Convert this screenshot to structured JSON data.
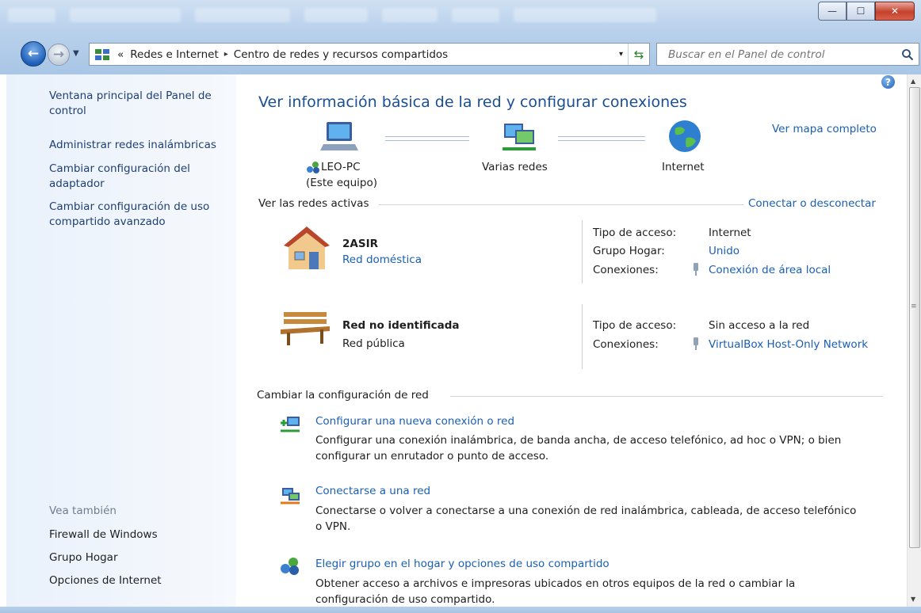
{
  "window": {
    "minimize": "—",
    "maximize": "☐",
    "close": "✕"
  },
  "address": {
    "overflow": "«",
    "crumb1": "Redes e Internet",
    "sep": "▸",
    "crumb2": "Centro de redes y recursos compartidos",
    "dropdown": "▾",
    "refresh": "⇆"
  },
  "search": {
    "placeholder": "Buscar en el Panel de control"
  },
  "sidebar": {
    "link1": "Ventana principal del Panel de control",
    "link2": "Administrar redes inalámbricas",
    "link3": "Cambiar configuración del adaptador",
    "link4": "Cambiar configuración de uso compartido avanzado",
    "see_also": "Vea también",
    "see1": "Firewall de Windows",
    "see2": "Grupo Hogar",
    "see3": "Opciones de Internet"
  },
  "main": {
    "title": "Ver información básica de la red y configurar conexiones",
    "full_map": "Ver mapa completo",
    "node1_name": "LEO-PC",
    "node1_sub": "(Este equipo)",
    "node2_name": "Varias redes",
    "node3_name": "Internet",
    "active_header": "Ver las redes activas",
    "connect_link": "Conectar o desconectar",
    "net1": {
      "name": "2ASIR",
      "type": "Red doméstica",
      "access_label": "Tipo de acceso:",
      "access_value": "Internet",
      "group_label": "Grupo Hogar:",
      "group_value": "Unido",
      "conn_label": "Conexiones:",
      "conn_value": "Conexión de área local"
    },
    "net2": {
      "name": "Red no identificada",
      "type": "Red pública",
      "access_label": "Tipo de acceso:",
      "access_value": "Sin acceso a la red",
      "conn_label": "Conexiones:",
      "conn_value": "VirtualBox Host-Only Network"
    },
    "change_header": "Cambiar la configuración de red",
    "task1_link": "Configurar una nueva conexión o red",
    "task1_desc1": "Configurar una conexión inalámbrica, de banda ancha, de acceso telefónico, ad hoc o VPN; o bien",
    "task1_desc2": "configurar un enrutador o punto de acceso.",
    "task2_link": "Conectarse a una red",
    "task2_desc1": "Conectarse o volver a conectarse a una conexión de red inalámbrica, cableada, de acceso telefónico",
    "task2_desc2": "o VPN.",
    "task3_link": "Elegir grupo en el hogar y opciones de uso compartido",
    "task3_desc1": "Obtener acceso a archivos e impresoras ubicados en otros equipos de la red o cambiar la",
    "task3_desc2": "configuración de uso compartido."
  }
}
